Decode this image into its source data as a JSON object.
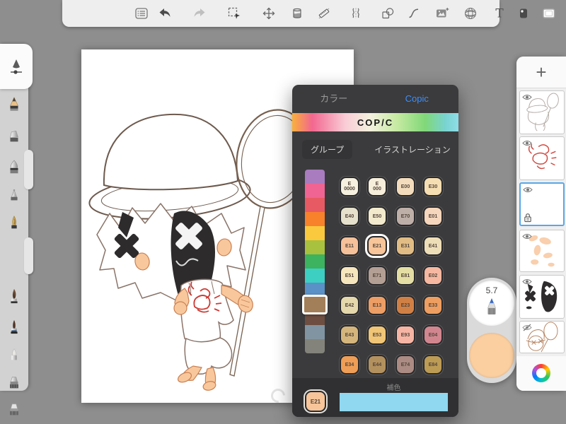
{
  "toolbar": {
    "icons": [
      "menu-list",
      "undo",
      "redo",
      "marquee-select",
      "move",
      "fill-jar",
      "ruler",
      "symmetry",
      "shapes",
      "curve",
      "import-image",
      "perspective-grid",
      "text-tool",
      "swatch",
      "frame"
    ]
  },
  "tools": {
    "items": [
      "tool-settings",
      "pencil",
      "eraser",
      "wide-marker",
      "fineliner",
      "fountain-pen",
      "paint-brush",
      "detail-brush",
      "pastel",
      "flat-marker",
      "flat-marker-2"
    ],
    "selected": "tool-settings"
  },
  "copic": {
    "tab_color": "カラー",
    "tab_copic": "Copic",
    "logo": "COP/C",
    "group_button": "グループ",
    "collection_label": "イラストレーション",
    "strip": [
      {
        "color": "#a87cbe"
      },
      {
        "color": "#ef6492"
      },
      {
        "color": "#e75a63"
      },
      {
        "color": "#f8812b"
      },
      {
        "color": "#fbc93d"
      },
      {
        "color": "#a8c13e"
      },
      {
        "color": "#3db25f"
      },
      {
        "color": "#3dcfc2"
      },
      {
        "color": "#5a91c7"
      },
      {
        "color": "#a27f59",
        "selected": true
      },
      {
        "color": "#6d4e40"
      },
      {
        "color": "#8194a2"
      },
      {
        "color": "#84837b"
      }
    ],
    "grid": [
      {
        "code": "E0000",
        "label": "E\n0000",
        "color": "#f5f0e0"
      },
      {
        "code": "E000",
        "label": "E\n000",
        "color": "#f6eedb"
      },
      {
        "code": "E00",
        "label": "E00",
        "color": "#f3dcbd"
      },
      {
        "code": "E30",
        "label": "E30",
        "color": "#f5deb2"
      },
      {
        "code": "E40",
        "label": "E40",
        "color": "#e6e1cc"
      },
      {
        "code": "E50",
        "label": "E50",
        "color": "#f3eacd"
      },
      {
        "code": "E70",
        "label": "E70",
        "color": "#beafa8"
      },
      {
        "code": "E01",
        "label": "E01",
        "color": "#f6d6bc"
      },
      {
        "code": "E11",
        "label": "E11",
        "color": "#f5c19a"
      },
      {
        "code": "E21",
        "label": "E21",
        "color": "#f7c599",
        "selected": true
      },
      {
        "code": "E31",
        "label": "E31",
        "color": "#e1bc84"
      },
      {
        "code": "E41",
        "label": "E41",
        "color": "#eedeb8"
      },
      {
        "code": "E51",
        "label": "E51",
        "color": "#f6e6be"
      },
      {
        "code": "E71",
        "label": "E71",
        "color": "#b49f95"
      },
      {
        "code": "E81",
        "label": "E81",
        "color": "#e4dea4"
      },
      {
        "code": "E02",
        "label": "E02",
        "color": "#f6b8a1"
      },
      {
        "code": "E42",
        "label": "E42",
        "color": "#e4d8ac"
      },
      {
        "code": "E13",
        "label": "E13",
        "color": "#ed9e65"
      },
      {
        "code": "E23",
        "label": "E23",
        "color": "#d18045"
      },
      {
        "code": "E33",
        "label": "E33",
        "color": "#ee9e60"
      },
      {
        "code": "E43",
        "label": "E43",
        "color": "#d4b67d"
      },
      {
        "code": "E53",
        "label": "E53",
        "color": "#f0c576"
      },
      {
        "code": "E93",
        "label": "E93",
        "color": "#f6b5a4"
      },
      {
        "code": "E04",
        "label": "E04",
        "color": "#d1868f"
      },
      {
        "code": "E34",
        "label": "E34",
        "color": "#ee9e56"
      },
      {
        "code": "E44",
        "label": "E44",
        "color": "#b3915e"
      },
      {
        "code": "E74",
        "label": "E74",
        "color": "#ab8b83"
      },
      {
        "code": "E84",
        "label": "E84",
        "color": "#bc9b54"
      }
    ],
    "selected_swatch": {
      "code": "E21",
      "color": "#f7c599"
    },
    "complement": {
      "label": "補色",
      "color": "#8fd8f0"
    }
  },
  "brush": {
    "size": "5.7",
    "color": "#fbcfa0"
  },
  "layers": {
    "add_button": "+",
    "items": [
      {
        "name": "layer-lineart",
        "visible": true
      },
      {
        "name": "layer-red-sketch",
        "visible": true
      },
      {
        "name": "layer-current",
        "visible": true,
        "selected": true,
        "locked": true
      },
      {
        "name": "layer-skin",
        "visible": true
      },
      {
        "name": "layer-mask",
        "visible": true
      },
      {
        "name": "layer-rough-sketch",
        "visible": false
      }
    ]
  },
  "accents": {
    "tab_blue": "#3f8ef7",
    "layer_selected": "#58a7e8",
    "workspace": "#8e8e8e"
  }
}
